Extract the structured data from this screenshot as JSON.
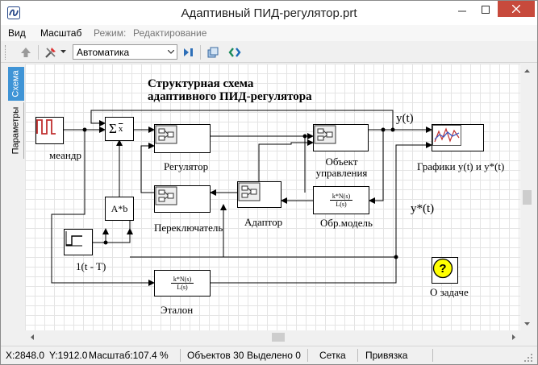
{
  "window": {
    "title": "Адаптивный ПИД-регулятор.prt"
  },
  "menu": {
    "items": [
      "Вид",
      "Масштаб"
    ],
    "mode_label": "Режим:",
    "mode_value": "Редактирование"
  },
  "toolbar": {
    "mode_select": "Автоматика"
  },
  "side_tabs": [
    "Схема",
    "Параметры"
  ],
  "diagram": {
    "title_line1": "Структурная схема",
    "title_line2": "адаптивного ПИД-регулятора",
    "blocks": {
      "meander": "меандр",
      "summator_symbol": "Σ",
      "summator_out": "x",
      "regulator": "Регулятор",
      "plant_line1": "Объект",
      "plant_line2": "управления",
      "graphs": "Графики y(t) и y*(t)",
      "switch": "Переключатель",
      "adaptor": "Адаптор",
      "inverse_model_num": "k*N(s)",
      "inverse_model_den": "L(s)",
      "inverse_model": "Обр.модель",
      "gain": "A*b",
      "step": "1(t - T)",
      "reference_num": "k*N(s)",
      "reference_den": "L(s)",
      "reference": "Эталон",
      "about": "О задаче",
      "about_icon": "?"
    },
    "signals": {
      "y": "y(t)",
      "y_star": "y*(t)"
    }
  },
  "status": {
    "x": "X:2848.0",
    "y": "Y:1912.0",
    "zoom": "Масштаб:107.4 %",
    "objects": "Объектов 30",
    "selected": "Выделено 0",
    "grid": "Сетка",
    "snap": "Привязка"
  },
  "colors": {
    "accent_tab": "#3f94d6",
    "close_button": "#c74a3c",
    "about_fill": "#ffff00"
  }
}
